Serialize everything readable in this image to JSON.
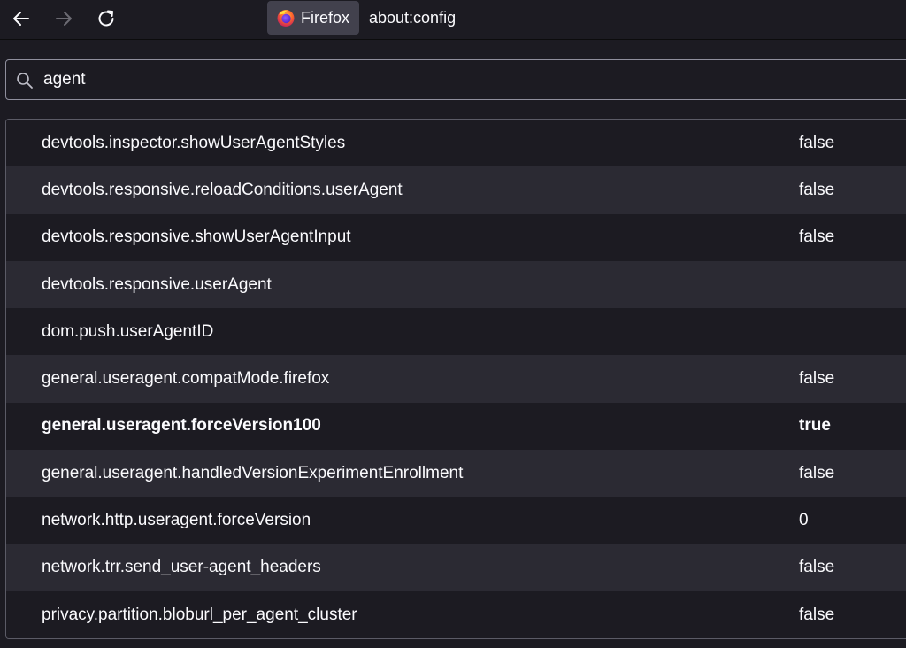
{
  "browser": {
    "identity_label": "Firefox",
    "url": "about:config",
    "icons": {
      "back": "arrow-left-icon",
      "forward": "arrow-right-icon",
      "reload": "reload-icon",
      "logo": "firefox-logo-icon"
    }
  },
  "search": {
    "value": "agent",
    "icon": "search-icon"
  },
  "preferences": [
    {
      "name": "devtools.inspector.showUserAgentStyles",
      "value": "false",
      "modified": false
    },
    {
      "name": "devtools.responsive.reloadConditions.userAgent",
      "value": "false",
      "modified": false
    },
    {
      "name": "devtools.responsive.showUserAgentInput",
      "value": "false",
      "modified": false
    },
    {
      "name": "devtools.responsive.userAgent",
      "value": "",
      "modified": false
    },
    {
      "name": "dom.push.userAgentID",
      "value": "",
      "modified": false
    },
    {
      "name": "general.useragent.compatMode.firefox",
      "value": "false",
      "modified": false
    },
    {
      "name": "general.useragent.forceVersion100",
      "value": "true",
      "modified": true
    },
    {
      "name": "general.useragent.handledVersionExperimentEnrollment",
      "value": "false",
      "modified": false
    },
    {
      "name": "network.http.useragent.forceVersion",
      "value": "0",
      "modified": false
    },
    {
      "name": "network.trr.send_user-agent_headers",
      "value": "false",
      "modified": false
    },
    {
      "name": "privacy.partition.bloburl_per_agent_cluster",
      "value": "false",
      "modified": false
    }
  ],
  "colors": {
    "background": "#1c1b22",
    "row_alt": "#2b2a33",
    "text": "#fbfbfe",
    "identity_box": "#42414d"
  }
}
